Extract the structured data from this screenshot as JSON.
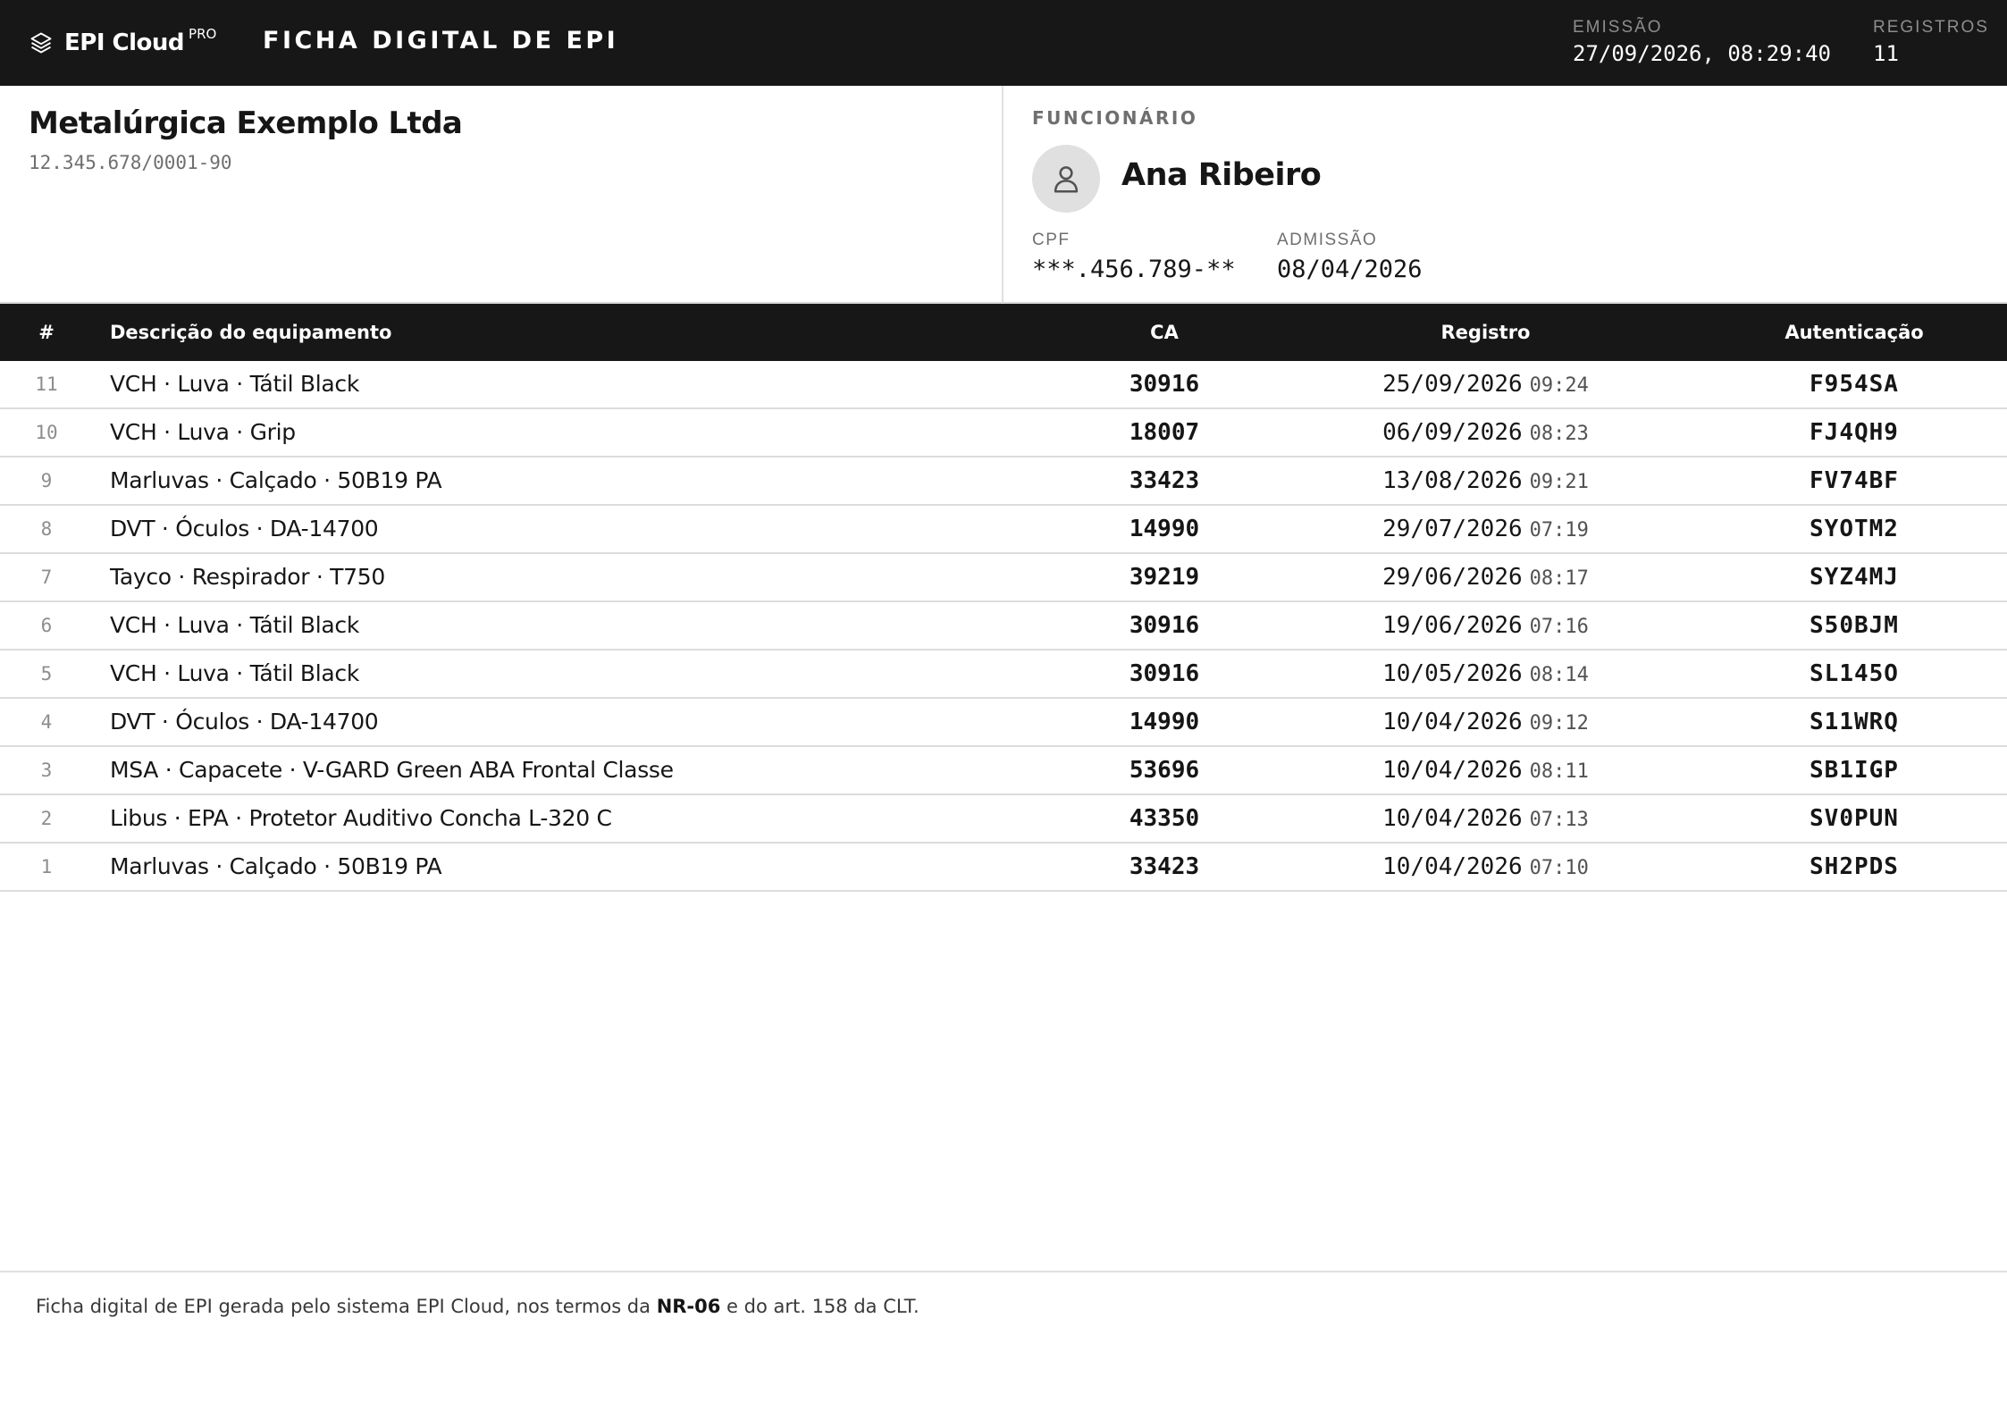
{
  "header": {
    "brand_name": "EPI Cloud",
    "brand_badge": "PRO",
    "document_title": "FICHA DIGITAL DE EPI",
    "emissao_label": "EMISSÃO",
    "emissao_value": "27/09/2026, 08:29:40",
    "registros_label": "REGISTROS",
    "registros_value": "11"
  },
  "company": {
    "name": "Metalúrgica Exemplo Ltda",
    "cnpj": "12.345.678/0001-90"
  },
  "employee": {
    "section_label": "FUNCIONÁRIO",
    "name": "Ana Ribeiro",
    "cpf_label": "CPF",
    "cpf_value": "***.456.789-**",
    "admissao_label": "ADMISSÃO",
    "admissao_value": "08/04/2026"
  },
  "table": {
    "columns": {
      "num": "#",
      "desc": "Descrição do equipamento",
      "ca": "CA",
      "registro": "Registro",
      "auth": "Autenticação"
    },
    "rows": [
      {
        "num": "11",
        "desc": "VCH · Luva · Tátil Black",
        "ca": "30916",
        "date": "25/09/2026",
        "time": "09:24",
        "auth": "F954SA"
      },
      {
        "num": "10",
        "desc": "VCH · Luva · Grip",
        "ca": "18007",
        "date": "06/09/2026",
        "time": "08:23",
        "auth": "FJ4QH9"
      },
      {
        "num": "9",
        "desc": "Marluvas · Calçado · 50B19 PA",
        "ca": "33423",
        "date": "13/08/2026",
        "time": "09:21",
        "auth": "FV74BF"
      },
      {
        "num": "8",
        "desc": "DVT · Óculos · DA-14700",
        "ca": "14990",
        "date": "29/07/2026",
        "time": "07:19",
        "auth": "SYOTM2"
      },
      {
        "num": "7",
        "desc": "Tayco · Respirador · T750",
        "ca": "39219",
        "date": "29/06/2026",
        "time": "08:17",
        "auth": "SYZ4MJ"
      },
      {
        "num": "6",
        "desc": "VCH · Luva · Tátil Black",
        "ca": "30916",
        "date": "19/06/2026",
        "time": "07:16",
        "auth": "S50BJM"
      },
      {
        "num": "5",
        "desc": "VCH · Luva · Tátil Black",
        "ca": "30916",
        "date": "10/05/2026",
        "time": "08:14",
        "auth": "SL145O"
      },
      {
        "num": "4",
        "desc": "DVT · Óculos · DA-14700",
        "ca": "14990",
        "date": "10/04/2026",
        "time": "09:12",
        "auth": "S11WRQ"
      },
      {
        "num": "3",
        "desc": "MSA · Capacete · V-GARD Green ABA Frontal Classe",
        "ca": "53696",
        "date": "10/04/2026",
        "time": "08:11",
        "auth": "SB1IGP"
      },
      {
        "num": "2",
        "desc": "Libus · EPA · Protetor Auditivo Concha L-320 C",
        "ca": "43350",
        "date": "10/04/2026",
        "time": "07:13",
        "auth": "SV0PUN"
      },
      {
        "num": "1",
        "desc": "Marluvas · Calçado · 50B19 PA",
        "ca": "33423",
        "date": "10/04/2026",
        "time": "07:10",
        "auth": "SH2PDS"
      }
    ]
  },
  "footer": {
    "text_before": "Ficha digital de EPI gerada pelo sistema EPI Cloud, nos termos da ",
    "text_bold": "NR-06",
    "text_after": " e do art. 158 da CLT."
  },
  "icons": {
    "brand": "layers-icon",
    "avatar": "user-icon"
  },
  "colors": {
    "header_bg": "#171717",
    "text_primary": "#161616",
    "text_muted": "#6f6f6f",
    "divider": "#dcdcdc",
    "avatar_bg": "#e0e0e0"
  }
}
